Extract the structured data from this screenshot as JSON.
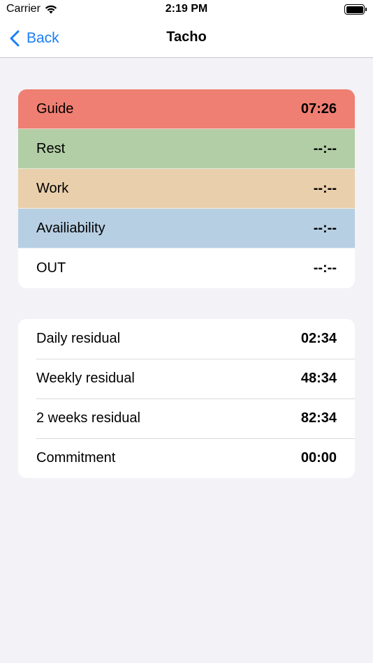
{
  "status_bar": {
    "carrier": "Carrier",
    "time": "2:19 PM"
  },
  "nav": {
    "back_label": "Back",
    "title": "Tacho"
  },
  "activities": [
    {
      "label": "Guide",
      "value": "07:26",
      "color": "#ef7f72"
    },
    {
      "label": "Rest",
      "value": "--:--",
      "color": "#b2cea6"
    },
    {
      "label": "Work",
      "value": "--:--",
      "color": "#e9cfac"
    },
    {
      "label": "Availiability",
      "value": "--:--",
      "color": "#b7cfe3"
    },
    {
      "label": "OUT",
      "value": "--:--",
      "color": "#ffffff"
    }
  ],
  "residuals": [
    {
      "label": "Daily residual",
      "value": "02:34"
    },
    {
      "label": "Weekly residual",
      "value": "48:34"
    },
    {
      "label": "2 weeks residual",
      "value": "82:34"
    },
    {
      "label": "Commitment",
      "value": "00:00"
    }
  ],
  "colors": {
    "accent": "#1a7ef5",
    "background": "#f2f2f7"
  }
}
